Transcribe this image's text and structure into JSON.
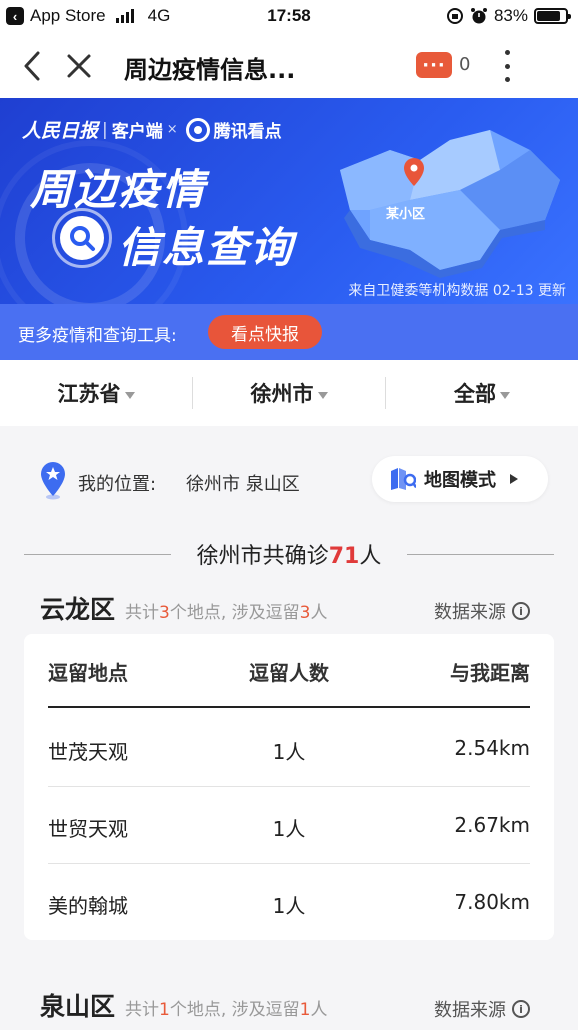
{
  "status_bar": {
    "carrier": "App Store",
    "network": "4G",
    "time": "17:58",
    "battery": "83%",
    "battery_level": 0.83
  },
  "nav": {
    "title": "周边疫情信息...",
    "comment_icon_text": "···",
    "comment_count": "0"
  },
  "banner": {
    "brand_people": "人民日报",
    "brand_client": "客户端",
    "brand_x": "×",
    "brand_tencent": "腾讯看点",
    "title_line1": "周边疫情",
    "title_line2": "信息查询",
    "map_label": "某小区",
    "source_note": "来自卫健委等机构数据  02-13 更新"
  },
  "tools": {
    "label": "更多疫情和查询工具:",
    "button": "看点快报"
  },
  "filters": {
    "province": "江苏省",
    "city": "徐州市",
    "scope": "全部"
  },
  "location": {
    "label": "我的位置:",
    "value": "徐州市 泉山区",
    "map_mode": "地图模式"
  },
  "summary": {
    "prefix": "徐州市共确诊",
    "count": "71",
    "suffix": "人"
  },
  "districts": [
    {
      "name": "云龙区",
      "sub_a": "共计",
      "places": "3",
      "sub_b": "个地点, 涉及逗留",
      "people": "3",
      "sub_c": "人",
      "source": "数据来源"
    },
    {
      "name": "泉山区",
      "sub_a": "共计",
      "places": "1",
      "sub_b": "个地点, 涉及逗留",
      "people": "1",
      "sub_c": "人",
      "source": "数据来源"
    }
  ],
  "table": {
    "headers": [
      "逗留地点",
      "逗留人数",
      "与我距离"
    ],
    "rows": [
      {
        "place": "世茂天观",
        "count": "1人",
        "distance": "2.54km"
      },
      {
        "place": "世贸天观",
        "count": "1人",
        "distance": "2.67km"
      },
      {
        "place": "美的翰城",
        "count": "1人",
        "distance": "7.80km"
      }
    ]
  },
  "colors": {
    "banner_blue": "#2a5cf0",
    "tools_blue": "#4a70f2",
    "accent_red": "#e85a3a",
    "count_red": "#e03a3a"
  }
}
